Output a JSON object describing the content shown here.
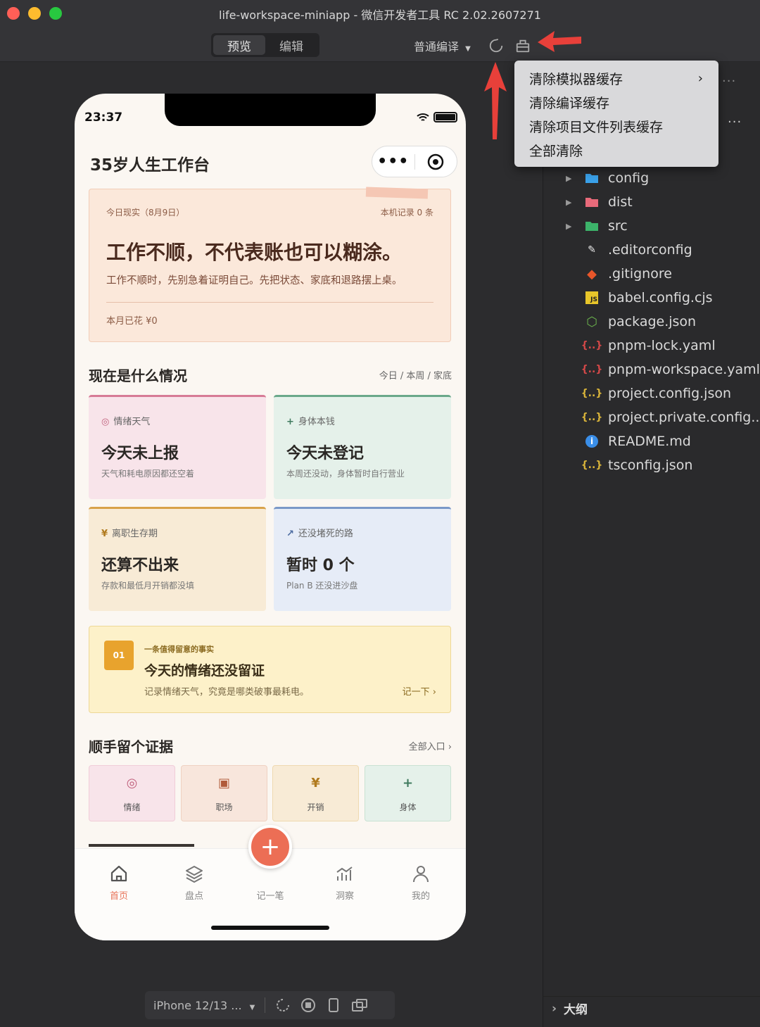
{
  "window": {
    "title": "life-workspace-miniapp - 微信开发者工具 RC 2.02.2607271"
  },
  "toolbar": {
    "tab_preview": "预览",
    "tab_edit": "编辑",
    "compile_mode": "普通编译"
  },
  "menu": {
    "items": [
      "清除模拟器缓存",
      "清除编译缓存",
      "清除项目文件列表缓存",
      "全部清除"
    ]
  },
  "phone": {
    "time": "23:37",
    "app_title": "35岁人生工作台",
    "hero": {
      "date": "今日现实（8月9日）",
      "record_count": "本机记录 0 条",
      "headline": "工作不顺，不代表账也可以糊涂。",
      "subtitle": "工作不顺时，先别急着证明自己。先把状态、家底和退路摆上桌。",
      "monthly_spend": "本月已花 ¥0"
    },
    "status_section": {
      "title": "现在是什么情况",
      "scope": "今日 / 本周 / 家底",
      "cards": [
        {
          "icon": "◎",
          "label": "情绪天气",
          "value": "今天未上报",
          "note": "天气和耗电原因都还空着",
          "color": "#d77b96"
        },
        {
          "icon": "+",
          "label": "身体本钱",
          "value": "今天未登记",
          "note": "本周还没动，身体暂时自行营业",
          "color": "#6aa88a"
        },
        {
          "icon": "¥",
          "label": "离职生存期",
          "value": "还算不出来",
          "note": "存款和最低月开销都没填",
          "color": "#d8a24a"
        },
        {
          "icon": "↗",
          "label": "还没堵死的路",
          "value": "暂时 0 个",
          "note": "Plan B 还没进沙盘",
          "color": "#7a98c8"
        }
      ]
    },
    "fact": {
      "badge": "01",
      "label": "一条值得留意的事实",
      "headline": "今天的情绪还没留证",
      "subtitle": "记录情绪天气，究竟是哪类破事最耗电。",
      "link": "记一下 ›"
    },
    "evidence_section": {
      "title": "顺手留个证据",
      "all_link": "全部入口 ›",
      "actions": [
        {
          "icon": "◎",
          "label": "情绪"
        },
        {
          "icon": "▣",
          "label": "职场"
        },
        {
          "icon": "¥",
          "label": "开销"
        },
        {
          "icon": "+",
          "label": "身体"
        }
      ]
    },
    "tabbar": {
      "items": [
        "首页",
        "盘点",
        "记一笔",
        "洞察",
        "我的"
      ],
      "active": "首页",
      "fab_icon": "+"
    }
  },
  "device_bar": {
    "device": "iPhone 12/13 ..."
  },
  "file_tree": {
    "items": [
      {
        "name": "config",
        "type": "folder",
        "icon_color": "#3aa0e8"
      },
      {
        "name": "dist",
        "type": "folder",
        "icon_color": "#e86a7a"
      },
      {
        "name": "src",
        "type": "folder",
        "icon_color": "#3cb36a"
      },
      {
        "name": ".editorconfig",
        "type": "file",
        "icon_color": "#e8e8e8"
      },
      {
        "name": ".gitignore",
        "type": "file",
        "icon_color": "#e8562a"
      },
      {
        "name": "babel.config.cjs",
        "type": "file",
        "icon_color": "#e8c62a"
      },
      {
        "name": "package.json",
        "type": "file",
        "icon_color": "#6ab04c"
      },
      {
        "name": "pnpm-lock.yaml",
        "type": "file",
        "icon_color": "#d44848"
      },
      {
        "name": "pnpm-workspace.yaml",
        "type": "file",
        "icon_color": "#d44848"
      },
      {
        "name": "project.config.json",
        "type": "file",
        "icon_color": "#d9b43a"
      },
      {
        "name": "project.private.config...",
        "type": "file",
        "icon_color": "#d9b43a"
      },
      {
        "name": "README.md",
        "type": "file",
        "icon_color": "#3a8ee8"
      },
      {
        "name": "tsconfig.json",
        "type": "file",
        "icon_color": "#d9b43a"
      }
    ],
    "outline_label": "大纲"
  },
  "colors": {
    "accent": "#ec6e55",
    "annotation_arrow": "#e8403a"
  }
}
